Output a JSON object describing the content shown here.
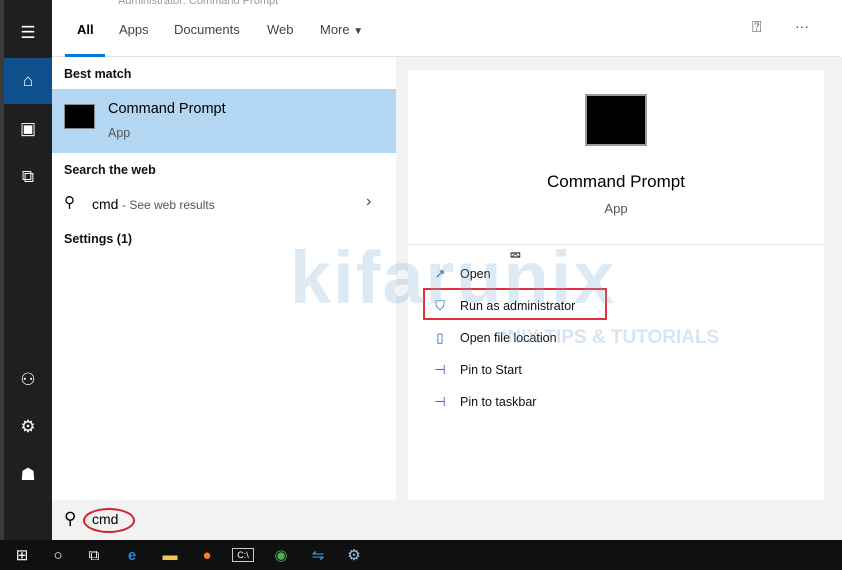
{
  "background_window": {
    "title": "Administrator: Command Prompt"
  },
  "rail": {
    "items": [
      {
        "icon": "hamburger-icon"
      },
      {
        "icon": "home-icon",
        "active": true
      },
      {
        "icon": "notebook-icon"
      },
      {
        "icon": "devices-icon"
      },
      {
        "icon": "add-user-icon"
      },
      {
        "icon": "gear-icon"
      },
      {
        "icon": "feedback-icon"
      }
    ]
  },
  "tabs": [
    {
      "label": "All",
      "active": true
    },
    {
      "label": "Apps"
    },
    {
      "label": "Documents"
    },
    {
      "label": "Web"
    },
    {
      "label": "More"
    }
  ],
  "topbar": {
    "more_menu": "···"
  },
  "results": {
    "best_match_header": "Best match",
    "best_match": {
      "title": "Command Prompt",
      "subtitle": "App"
    },
    "web_header": "Search the web",
    "web_item": {
      "query": "cmd",
      "suffix": " - See web results"
    },
    "settings_header": "Settings (1)"
  },
  "preview": {
    "title": "Command Prompt",
    "subtitle": "App",
    "actions": [
      {
        "label": "Open",
        "icon": "open-icon"
      },
      {
        "label": "Run as administrator",
        "icon": "shield-icon",
        "highlighted": true
      },
      {
        "label": "Open file location",
        "icon": "file-location-icon"
      },
      {
        "label": "Pin to Start",
        "icon": "pin-icon"
      },
      {
        "label": "Pin to taskbar",
        "icon": "pin-icon"
      }
    ]
  },
  "watermark": {
    "text": "kifarunix",
    "tagline": "*NIX TIPS & TUTORIALS"
  },
  "search": {
    "value": "cmd"
  },
  "colors": {
    "accent": "#0078d7",
    "selected": "#b3d7f2",
    "highlight_box": "#e0303a"
  }
}
